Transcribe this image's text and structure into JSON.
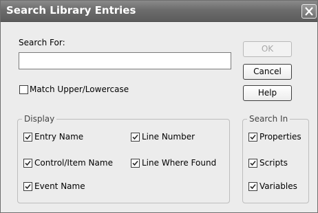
{
  "window": {
    "title": "Search Library Entries"
  },
  "search": {
    "label": "Search For:",
    "value": "",
    "match_case_label": "Match Upper/Lowercase",
    "match_case_checked": false
  },
  "buttons": {
    "ok": "OK",
    "cancel": "Cancel",
    "help": "Help"
  },
  "display": {
    "legend": "Display",
    "entry_name": "Entry Name",
    "line_number": "Line Number",
    "control_item_name": "Control/Item Name",
    "line_where_found": "Line Where Found",
    "event_name": "Event Name"
  },
  "search_in": {
    "legend": "Search In",
    "properties": "Properties",
    "scripts": "Scripts",
    "variables": "Variables"
  }
}
